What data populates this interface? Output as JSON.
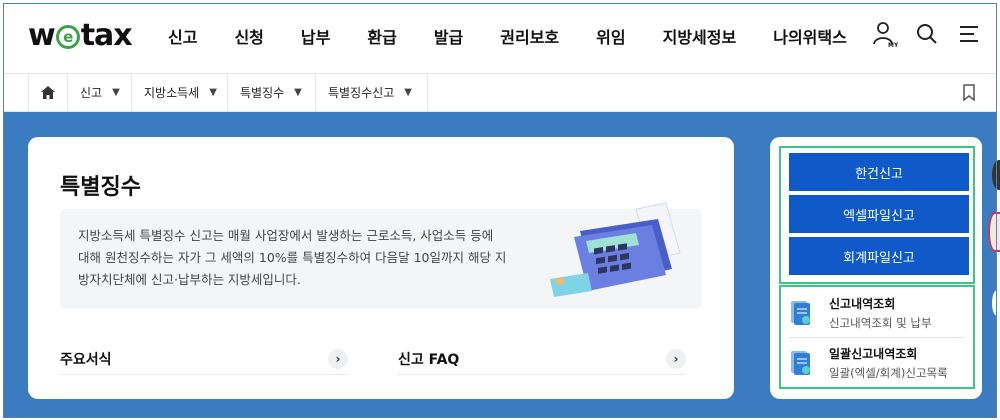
{
  "header": {
    "logo_text_before": "w",
    "logo_text_e": "e",
    "logo_text_after": "tax",
    "nav": [
      "신고",
      "신청",
      "납부",
      "환급",
      "발급",
      "권리보호",
      "위임",
      "지방세정보",
      "나의위택스"
    ],
    "icons": [
      "my-page-icon",
      "search-icon",
      "menu-icon"
    ]
  },
  "breadcrumb": {
    "home_icon": "home-icon",
    "items": [
      "신고",
      "지방소득세",
      "특별징수",
      "특별징수신고"
    ],
    "arrow": "▼",
    "bookmark_icon": "bookmark-icon"
  },
  "main": {
    "title": "특별징수",
    "description": "지방소득세 특별징수 신고는 매월 사업장에서 발생하는 근로소득, 사업소득 등에 대해 원천징수하는 자가 그 세액의 10%를 특별징수하여 다음달 10일까지 해당 지방자치단체에 신고·납부하는 지방세입니다.",
    "links": [
      {
        "label": "주요서식",
        "arrow": "›"
      },
      {
        "label": "신고 FAQ",
        "arrow": "›"
      }
    ]
  },
  "side": {
    "buttons": [
      "한건신고",
      "엑셀파일신고",
      "회계파일신고"
    ],
    "links": [
      {
        "title": "신고내역조회",
        "sub": "신고내역조회 및 납부"
      },
      {
        "title": "일괄신고내역조회",
        "sub": "일괄(엑셀/회계)신고목록"
      }
    ]
  },
  "colors": {
    "band": "#3b7bbf",
    "primary_button": "#0f5ac8",
    "highlight_border": "#3cc585",
    "logo_green": "#3aa24a"
  }
}
